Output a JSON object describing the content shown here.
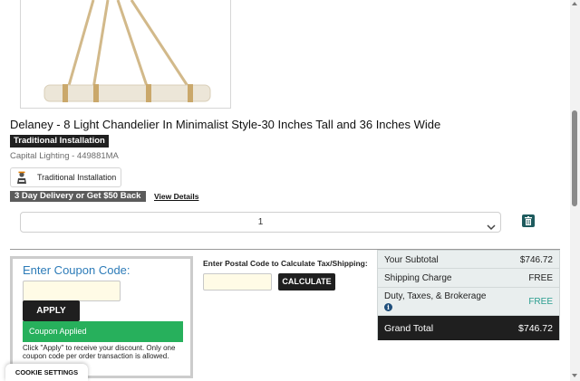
{
  "product": {
    "title": "Delaney - 8 Light Chandelier In Minimalist Style-30 Inches Tall and 36 Inches Wide",
    "install_badge": "Traditional Installation",
    "brand_sku": "Capital Lighting - 449881MA",
    "install_option_label": "Traditional Installation",
    "delivery_badge": "3 Day Delivery or Get $50 Back",
    "view_details": "View Details"
  },
  "quantity": {
    "value": "1"
  },
  "coupon": {
    "title": "Enter Coupon Code:",
    "input_value": "",
    "apply_label": "APPLY",
    "status": "Coupon Applied",
    "help_text": "Click \"Apply\" to receive your discount. Only one coupon code per order transaction is allowed."
  },
  "postal": {
    "label": "Enter Postal Code to Calculate Tax/Shipping:",
    "input_value": "",
    "calculate_label": "CALCULATE"
  },
  "summary": {
    "subtotal_label": "Your Subtotal",
    "subtotal_value": "$746.72",
    "shipping_label": "Shipping Charge",
    "shipping_value": "FREE",
    "duty_label": "Duty, Taxes, & Brokerage",
    "duty_value": "FREE",
    "info_glyph": "i",
    "total_label": "Grand Total",
    "total_value": "$746.72"
  },
  "cookie_settings": "COOKIE SETTINGS",
  "colors": {
    "coupon_title": "#2c7bb8",
    "coupon_applied": "#27b05c",
    "free_green": "#2a9d8f",
    "trash_button": "#1e5b5e",
    "total_bar": "#1f1f1f",
    "summary_bg": "#e9eeee"
  },
  "icons": {
    "product_image": "chandelier-photo",
    "install_option": "installer-person-icon",
    "quantity_dropdown": "chevron-down-icon",
    "remove_item": "trash-icon",
    "duty_info": "info-icon"
  }
}
